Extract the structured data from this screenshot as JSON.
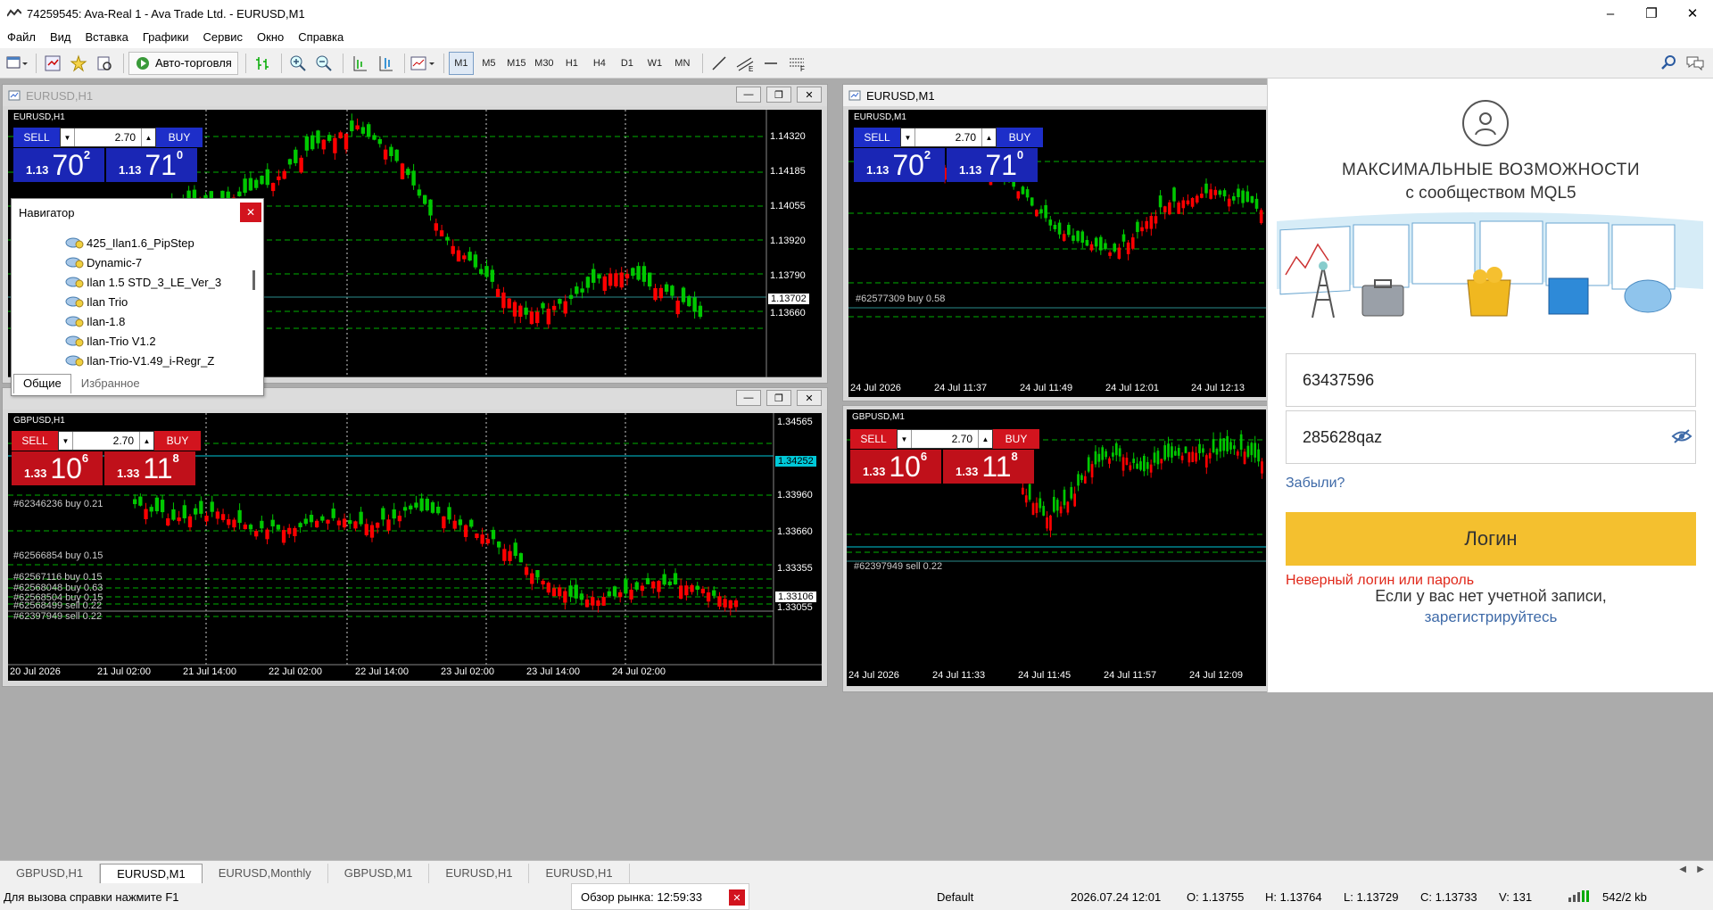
{
  "window": {
    "title": "74259545: Ava-Real 1 - Ava Trade Ltd. - EURUSD,M1",
    "controls": [
      "–",
      "❐",
      "✕"
    ]
  },
  "menu": [
    "Файл",
    "Вид",
    "Вставка",
    "Графики",
    "Сервис",
    "Окно",
    "Справка"
  ],
  "toolbar": {
    "autotrade_label": "Авто-торговля",
    "timeframes": [
      "M1",
      "M5",
      "M15",
      "M30",
      "H1",
      "H4",
      "D1",
      "W1",
      "MN"
    ],
    "active_timeframe": "M1"
  },
  "charts": {
    "eurusd_h1": {
      "window_title": "EURUSD,H1",
      "symbol_label": "EURUSD,H1",
      "trade": {
        "sell": "SELL",
        "buy": "BUY",
        "volume": "2.70",
        "bid_small": "1.13",
        "bid_big": "70",
        "bid_sup": "2",
        "ask_small": "1.13",
        "ask_big": "71",
        "ask_sup": "0"
      },
      "y_ticks": [
        "1.14320",
        "1.14185",
        "1.14055",
        "1.13920",
        "1.13790",
        "1.13660"
      ],
      "current_price": "1.13702",
      "x_ticks": []
    },
    "gbpusd_h1": {
      "window_title": "",
      "symbol_label": "GBPUSD,H1",
      "trade": {
        "sell": "SELL",
        "buy": "BUY",
        "volume": "2.70",
        "bid_small": "1.33",
        "bid_big": "10",
        "bid_sup": "6",
        "ask_small": "1.33",
        "ask_big": "11",
        "ask_sup": "8"
      },
      "y_ticks": [
        "1.34565",
        "1.33960",
        "1.33660",
        "1.33355",
        "1.33055"
      ],
      "cyan_price": "1.34252",
      "current_price": "1.33106",
      "orders": [
        "#62346236 buy 0.21",
        "#62566854 buy 0.15",
        "#62567116 buy 0.15",
        "#62568048 buy 0.63",
        "#62568504 buy 0.15",
        "#62568499 sell 0.22",
        "#62397949 sell 0.22"
      ],
      "x_ticks": [
        "20 Jul 2026",
        "21 Jul 02:00",
        "21 Jul 14:00",
        "22 Jul 02:00",
        "22 Jul 14:00",
        "23 Jul 02:00",
        "23 Jul 14:00",
        "24 Jul 02:00"
      ]
    },
    "eurusd_m1": {
      "window_title": "EURUSD,M1",
      "symbol_label": "EURUSD,M1",
      "trade": {
        "sell": "SELL",
        "buy": "BUY",
        "volume": "2.70",
        "bid_small": "1.13",
        "bid_big": "70",
        "bid_sup": "2",
        "ask_small": "1.13",
        "ask_big": "71",
        "ask_sup": "0"
      },
      "orders": [
        "#62577309 buy 0.58"
      ],
      "x_ticks": [
        "24 Jul 2026",
        "24 Jul 11:37",
        "24 Jul 11:49",
        "24 Jul 12:01",
        "24 Jul 12:13"
      ]
    },
    "gbpusd_m1": {
      "window_title": "",
      "symbol_label": "GBPUSD,M1",
      "trade": {
        "sell": "SELL",
        "buy": "BUY",
        "volume": "2.70",
        "bid_small": "1.33",
        "bid_big": "10",
        "bid_sup": "6",
        "ask_small": "1.33",
        "ask_big": "11",
        "ask_sup": "8"
      },
      "orders": [
        "#62397949 sell 0.22"
      ],
      "x_ticks": [
        "24 Jul 2026",
        "24 Jul 11:33",
        "24 Jul 11:45",
        "24 Jul 11:57",
        "24 Jul 12:09"
      ]
    }
  },
  "navigator": {
    "title": "Навигатор",
    "items": [
      "425_Ilan1.6_PipStep",
      "Dynamic-7",
      "Ilan 1.5 STD_3_LE_Ver_3",
      "Ilan Trio",
      "Ilan-1.8",
      "Ilan-Trio V1.2",
      "Ilan-Trio-V1.49_i-Regr_Z"
    ],
    "tabs": [
      "Общие",
      "Избранное"
    ]
  },
  "mql5": {
    "heading": "МАКСИМАЛЬНЫЕ ВОЗМОЖНОСТИ",
    "subheading": "с сообществом MQL5",
    "login_value": "63437596",
    "password_value": "285628qaz",
    "forgot": "Забыли?",
    "login_button": "Логин",
    "error": "Неверный логин или пароль",
    "no_account": "Если у вас нет учетной записи,",
    "register": "зарегистрируйтесь"
  },
  "bottom_tabs": [
    "GBPUSD,H1",
    "EURUSD,M1",
    "EURUSD,Monthly",
    "GBPUSD,M1",
    "EURUSD,H1",
    "EURUSD,H1"
  ],
  "active_bottom_tab": "EURUSD,M1",
  "status": {
    "help": "Для вызова справки нажмите F1",
    "market_watch": "Обзор рынка: 12:59:33",
    "profile": "Default",
    "datetime": "2026.07.24 12:01",
    "open": "O: 1.13755",
    "high": "H: 1.13764",
    "low": "L: 1.13729",
    "close": "C: 1.13733",
    "volume": "V: 131",
    "traffic": "542/2 kb"
  },
  "colors": {
    "bull": "#00c800",
    "bear": "#ff0000",
    "grid": "#00b000",
    "sell_blue": "#1d2ec9",
    "sell_red": "#d2141e",
    "login_yellow": "#f4c02f",
    "error_red": "#e0281a",
    "link_blue": "#3e6aa8"
  }
}
